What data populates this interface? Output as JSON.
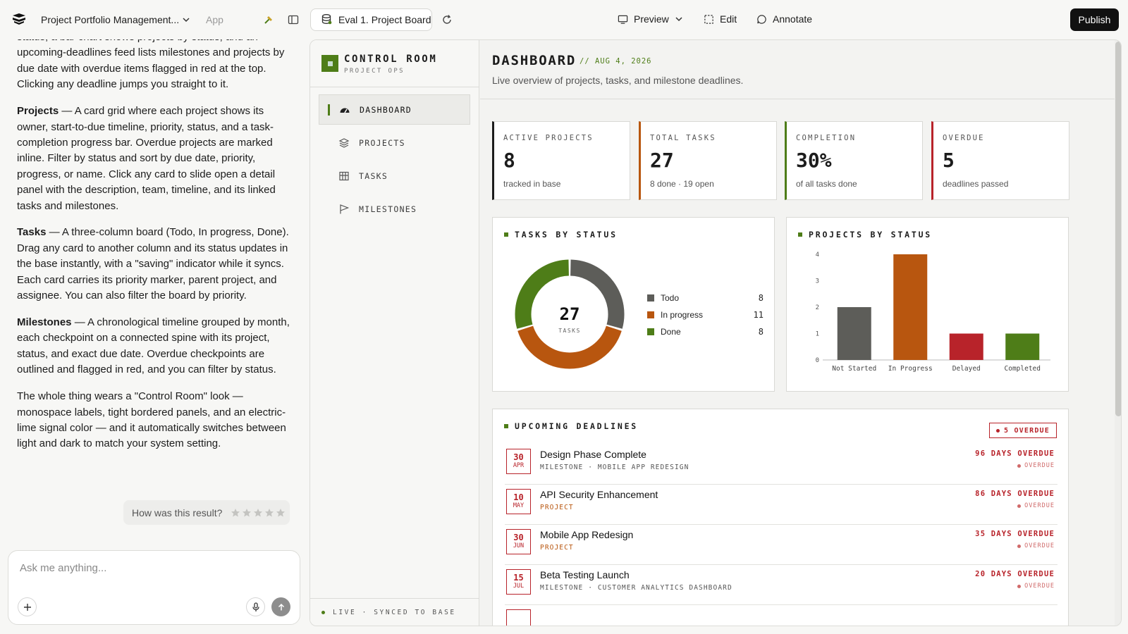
{
  "topbar": {
    "project_title": "Project Portfolio Management...",
    "app_label": "App",
    "eval_tab": "Eval 1. Project Board",
    "preview": "Preview",
    "edit": "Edit",
    "annotate": "Annotate",
    "publish": "Publish"
  },
  "chat": {
    "intro": "status, a bar chart shows projects by status, and an upcoming-deadlines feed lists milestones and projects by due date with overdue items flagged in red at the top. Clicking any deadline jumps you straight to it.",
    "projects_head": "Projects",
    "projects_text": " — A card grid where each project shows its owner, start-to-due timeline, priority, status, and a task-completion progress bar. Overdue projects are marked inline. Filter by status and sort by due date, priority, progress, or name. Click any card to slide open a detail panel with the description, team, timeline, and its linked tasks and milestones.",
    "tasks_head": "Tasks",
    "tasks_text": " — A three-column board (Todo, In progress, Done). Drag any card to another column and its status updates in the base instantly, with a \"saving\" indicator while it syncs. Each card carries its priority marker, parent project, and assignee. You can also filter the board by priority.",
    "milestones_head": "Milestones",
    "milestones_text": " — A chronological timeline grouped by month, each checkpoint on a connected spine with its project, status, and exact due date. Overdue checkpoints are outlined and flagged in red, and you can filter by status.",
    "outro": "The whole thing wears a \"Control Room\" look — monospace labels, tight bordered panels, and an electric-lime signal color — and it automatically switches between light and dark to match your system setting.",
    "rating_prompt": "How was this result?",
    "input_placeholder": "Ask me anything..."
  },
  "nav": {
    "brand_title": "CONTROL ROOM",
    "brand_sub": "PROJECT OPS",
    "items": [
      "DASHBOARD",
      "PROJECTS",
      "TASKS",
      "MILESTONES"
    ],
    "footer": "LIVE · SYNCED TO BASE"
  },
  "page": {
    "title": "DASHBOARD",
    "date": "// AUG 4, 2026",
    "desc": "Live overview of projects, tasks, and milestone deadlines."
  },
  "stats": [
    {
      "label": "ACTIVE PROJECTS",
      "value": "8",
      "sub": "tracked in base",
      "color": "#1c1c1c"
    },
    {
      "label": "TOTAL TASKS",
      "value": "27",
      "sub": "8 done · 19 open",
      "color": "#b8560f"
    },
    {
      "label": "COMPLETION",
      "value": "30%",
      "sub": "of all tasks done",
      "color": "#4e7d18"
    },
    {
      "label": "OVERDUE",
      "value": "5",
      "sub": "deadlines passed",
      "color": "#b8232a"
    }
  ],
  "tasks_panel": {
    "title": "TASKS BY STATUS",
    "center_value": "27",
    "center_label": "TASKS"
  },
  "projects_panel": {
    "title": "PROJECTS BY STATUS"
  },
  "chart_data": [
    {
      "type": "pie",
      "title": "TASKS BY STATUS",
      "categories": [
        "Todo",
        "In progress",
        "Done"
      ],
      "values": [
        8,
        11,
        8
      ],
      "colors": [
        "#5d5d59",
        "#b8560f",
        "#4e7d18"
      ]
    },
    {
      "type": "bar",
      "title": "PROJECTS BY STATUS",
      "categories": [
        "Not Started",
        "In Progress",
        "Delayed",
        "Completed"
      ],
      "values": [
        2,
        4,
        1,
        1
      ],
      "colors": [
        "#5d5d59",
        "#b8560f",
        "#b8232a",
        "#4e7d18"
      ],
      "yticks": [
        0,
        1,
        2,
        3,
        4
      ],
      "ylim": [
        0,
        4
      ]
    }
  ],
  "deadlines": {
    "title": "UPCOMING DEADLINES",
    "badge": "5 OVERDUE",
    "items": [
      {
        "day": "30",
        "month": "APR",
        "name": "Design Phase Complete",
        "meta": "MILESTONE · MOBILE APP REDESIGN",
        "kind": "milestone",
        "overdue": "96 DAYS OVERDUE",
        "status": "OVERDUE"
      },
      {
        "day": "10",
        "month": "MAY",
        "name": "API Security Enhancement",
        "meta": "PROJECT",
        "kind": "project",
        "overdue": "86 DAYS OVERDUE",
        "status": "OVERDUE"
      },
      {
        "day": "30",
        "month": "JUN",
        "name": "Mobile App Redesign",
        "meta": "PROJECT",
        "kind": "project",
        "overdue": "35 DAYS OVERDUE",
        "status": "OVERDUE"
      },
      {
        "day": "15",
        "month": "JUL",
        "name": "Beta Testing Launch",
        "meta": "MILESTONE · CUSTOMER ANALYTICS DASHBOARD",
        "kind": "milestone",
        "overdue": "20 DAYS OVERDUE",
        "status": "OVERDUE"
      }
    ]
  }
}
